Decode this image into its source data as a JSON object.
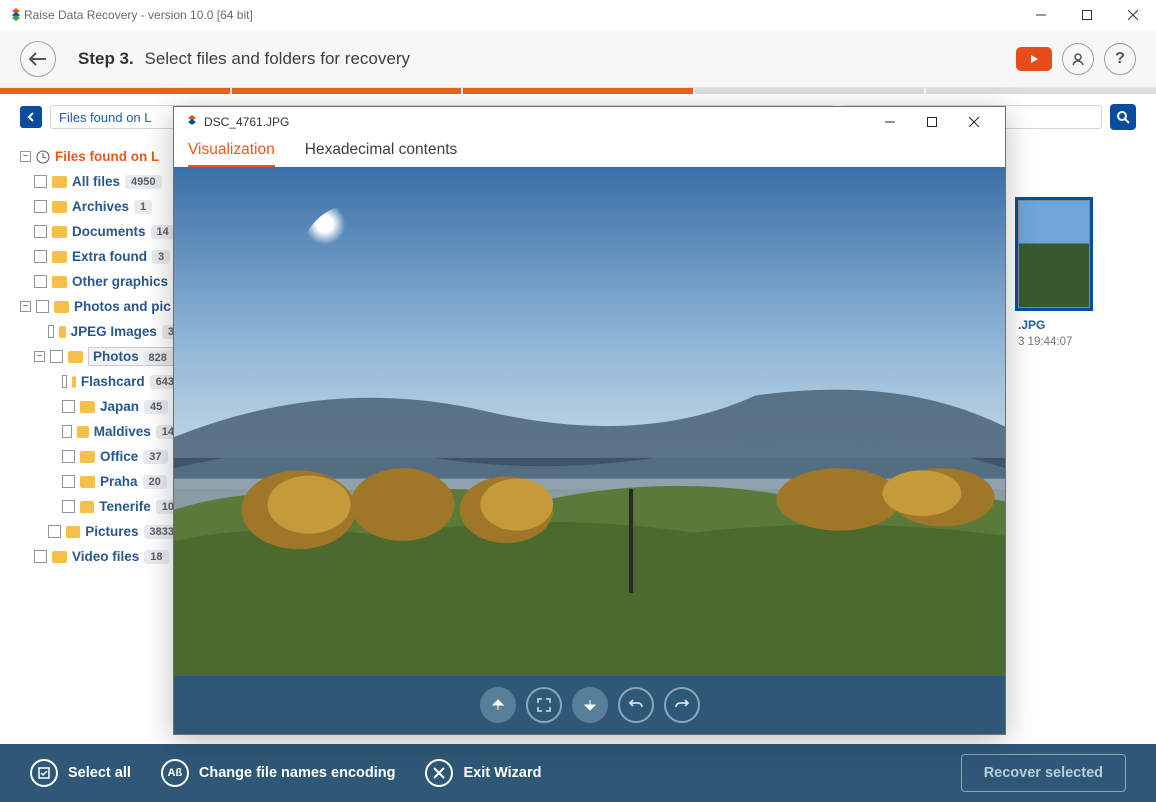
{
  "titlebar": {
    "title": "Raise Data Recovery - version 10.0 [64 bit]"
  },
  "header": {
    "step": "Step 3.",
    "subtitle": "Select files and folders for recovery"
  },
  "breadcrumb": {
    "text": "Files found on L"
  },
  "search": {
    "placeholder": ""
  },
  "tree": {
    "root": "Files found on L",
    "items": [
      {
        "label": "All files",
        "badge": "4950"
      },
      {
        "label": "Archives",
        "badge": "1"
      },
      {
        "label": "Documents",
        "badge": "14"
      },
      {
        "label": "Extra found",
        "badge": "3"
      },
      {
        "label": "Other graphics"
      },
      {
        "label": "Photos and pic"
      },
      {
        "label": "JPEG Images",
        "badge": "3"
      },
      {
        "label": "Photos",
        "badge": "828"
      },
      {
        "label": "Flashcard",
        "badge": "643"
      },
      {
        "label": "Japan",
        "badge": "45"
      },
      {
        "label": "Maldives",
        "badge": "14"
      },
      {
        "label": "Office",
        "badge": "37"
      },
      {
        "label": "Praha",
        "badge": "20"
      },
      {
        "label": "Tenerife",
        "badge": "10"
      },
      {
        "label": "Pictures",
        "badge": "3833"
      },
      {
        "label": "Video files",
        "badge": "18"
      }
    ]
  },
  "thumb": {
    "filename": ".JPG",
    "timestamp": "3 19:44:07"
  },
  "footer": {
    "selectAll": "Select all",
    "encoding": "Change file names encoding",
    "exit": "Exit Wizard",
    "recover": "Recover selected"
  },
  "preview": {
    "title": "DSC_4761.JPG",
    "tab1": "Visualization",
    "tab2": "Hexadecimal contents"
  }
}
